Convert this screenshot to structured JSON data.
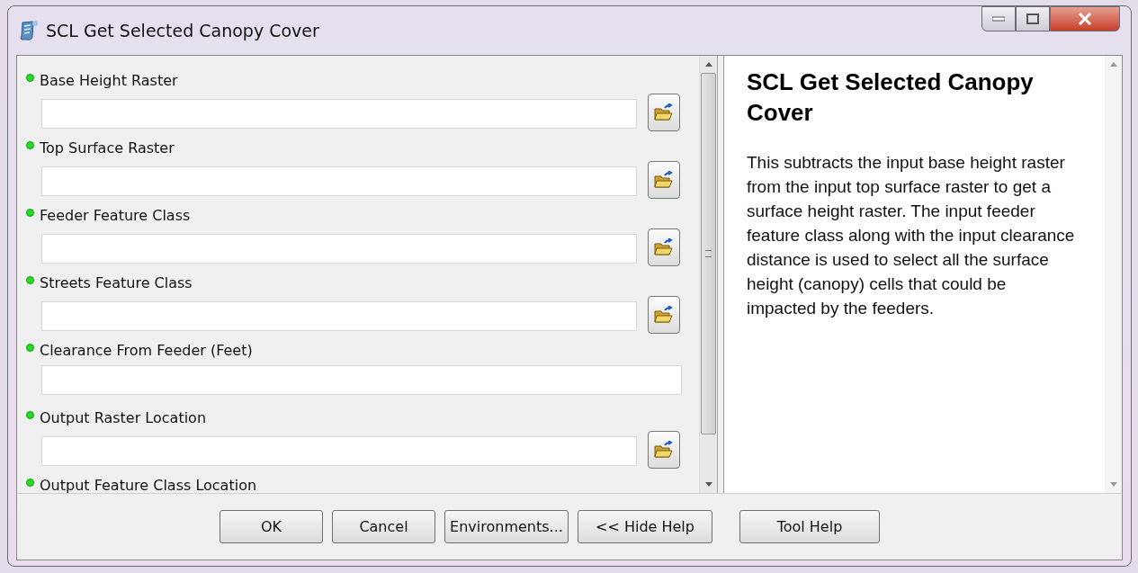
{
  "window": {
    "title": "SCL Get Selected Canopy Cover"
  },
  "parameters": [
    {
      "label": "Base Height Raster",
      "kind": "browse"
    },
    {
      "label": "Top Surface Raster",
      "kind": "browse"
    },
    {
      "label": "Feeder Feature Class",
      "kind": "browse"
    },
    {
      "label": "Streets Feature Class",
      "kind": "browse"
    },
    {
      "label": "Clearance From Feeder (Feet)",
      "kind": "text"
    },
    {
      "label": "Output Raster Location",
      "kind": "browse"
    },
    {
      "label": "Output Feature Class Location",
      "kind": "label"
    }
  ],
  "help": {
    "title": "SCL Get Selected Canopy Cover",
    "body": "This subtracts the input base height raster from the input top surface raster to get a surface height raster. The input feeder feature class along with the input clearance distance is used to select all the surface height (canopy) cells that could be impacted by the feeders."
  },
  "buttons": [
    "OK",
    "Cancel",
    "Environments...",
    "<< Hide Help"
  ],
  "tool_help_button": "Tool Help"
}
